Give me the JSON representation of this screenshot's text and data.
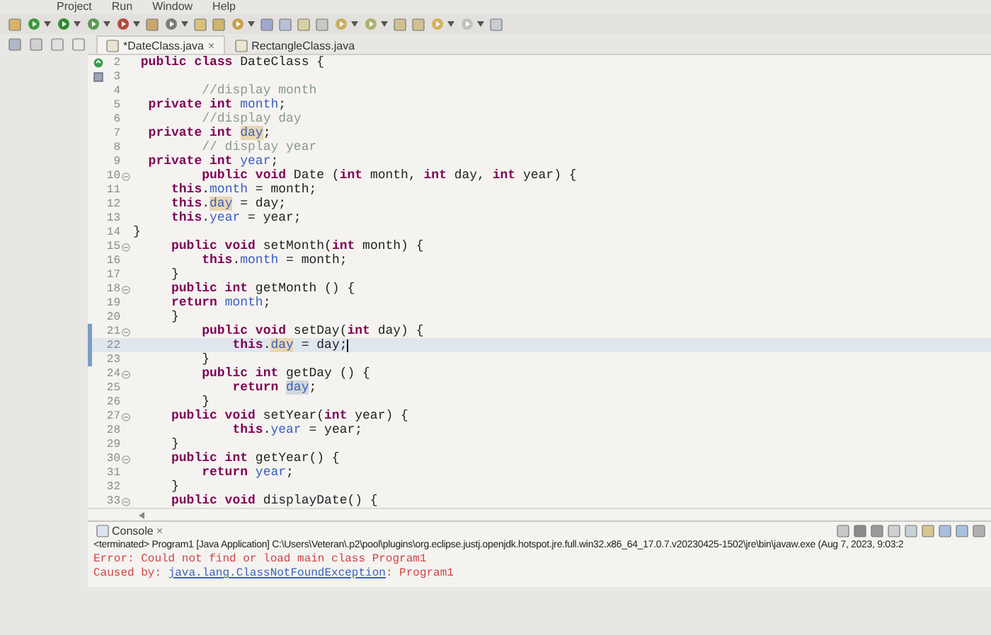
{
  "menu": [
    "Project",
    "Run",
    "Window",
    "Help"
  ],
  "tabs": [
    {
      "label": "*DateClass.java",
      "selected": true,
      "close": "×"
    },
    {
      "label": "RectangleClass.java",
      "selected": false
    }
  ],
  "editor": {
    "lines": [
      {
        "number": "2",
        "marker": {
          "kind": "override"
        },
        "fold": false,
        "marked": false,
        "current": false,
        "tokens": [
          {
            "kind": "kw",
            "text": " public class"
          },
          {
            "kind": "text",
            "text": " DateClass {"
          }
        ]
      },
      {
        "number": "3",
        "marker": {
          "kind": "bookmark"
        },
        "fold": false,
        "marked": false,
        "current": false
      },
      {
        "number": "4",
        "fold": false,
        "marked": false,
        "current": false,
        "tokens": [
          {
            "kind": "comment",
            "text": "         //display month"
          }
        ]
      },
      {
        "number": "5",
        "fold": false,
        "marked": false,
        "current": false,
        "tokens": [
          {
            "kind": "kw",
            "text": "  private int "
          },
          {
            "kind": "field",
            "text": "month"
          },
          {
            "kind": "text",
            "text": ";"
          }
        ]
      },
      {
        "number": "6",
        "fold": false,
        "marked": false,
        "current": false,
        "tokens": [
          {
            "kind": "comment",
            "text": "         //display day"
          }
        ]
      },
      {
        "number": "7",
        "fold": false,
        "marked": false,
        "current": false,
        "tokens": [
          {
            "kind": "kw",
            "text": "  private int "
          },
          {
            "kind": "field-write",
            "text": "day"
          },
          {
            "kind": "text",
            "text": ";"
          }
        ]
      },
      {
        "number": "8",
        "fold": false,
        "marked": false,
        "current": false,
        "tokens": [
          {
            "kind": "comment",
            "text": "         // display year"
          }
        ]
      },
      {
        "number": "9",
        "fold": false,
        "marked": false,
        "current": false,
        "tokens": [
          {
            "kind": "kw",
            "text": "  private int "
          },
          {
            "kind": "field",
            "text": "year"
          },
          {
            "kind": "text",
            "text": ";"
          }
        ]
      },
      {
        "number": "10",
        "fold": true,
        "marked": false,
        "current": false,
        "tokens": [
          {
            "kind": "kw",
            "text": "         public void"
          },
          {
            "kind": "text",
            "text": " Date ("
          },
          {
            "kind": "kw",
            "text": "int"
          },
          {
            "kind": "text",
            "text": " month, "
          },
          {
            "kind": "kw",
            "text": "int"
          },
          {
            "kind": "text",
            "text": " day, "
          },
          {
            "kind": "kw",
            "text": "int"
          },
          {
            "kind": "text",
            "text": " year) {"
          }
        ]
      },
      {
        "number": "11",
        "fold": false,
        "marked": false,
        "current": false,
        "tokens": [
          {
            "kind": "kw",
            "text": "     this"
          },
          {
            "kind": "text",
            "text": "."
          },
          {
            "kind": "field",
            "text": "month"
          },
          {
            "kind": "text",
            "text": " = month;"
          }
        ]
      },
      {
        "number": "12",
        "fold": false,
        "marked": false,
        "current": false,
        "tokens": [
          {
            "kind": "kw",
            "text": "     this"
          },
          {
            "kind": "text",
            "text": "."
          },
          {
            "kind": "field-write",
            "text": "day"
          },
          {
            "kind": "text",
            "text": " = day;"
          }
        ]
      },
      {
        "number": "13",
        "fold": false,
        "marked": false,
        "current": false,
        "tokens": [
          {
            "kind": "kw",
            "text": "     this"
          },
          {
            "kind": "text",
            "text": "."
          },
          {
            "kind": "field",
            "text": "year"
          },
          {
            "kind": "text",
            "text": " = year;"
          }
        ]
      },
      {
        "number": "14",
        "fold": false,
        "marked": false,
        "current": false,
        "tokens": [
          {
            "kind": "text",
            "text": "}"
          }
        ]
      },
      {
        "number": "15",
        "fold": true,
        "marked": false,
        "current": false,
        "tokens": [
          {
            "kind": "kw",
            "text": "     public void"
          },
          {
            "kind": "text",
            "text": " setMonth("
          },
          {
            "kind": "kw",
            "text": "int"
          },
          {
            "kind": "text",
            "text": " month) {"
          }
        ]
      },
      {
        "number": "16",
        "fold": false,
        "marked": false,
        "current": false,
        "tokens": [
          {
            "kind": "kw",
            "text": "         this"
          },
          {
            "kind": "text",
            "text": "."
          },
          {
            "kind": "field",
            "text": "month"
          },
          {
            "kind": "text",
            "text": " = month;"
          }
        ]
      },
      {
        "number": "17",
        "fold": false,
        "marked": false,
        "current": false,
        "tokens": [
          {
            "kind": "text",
            "text": "     }"
          }
        ]
      },
      {
        "number": "18",
        "fold": true,
        "marked": false,
        "current": false,
        "tokens": [
          {
            "kind": "kw",
            "text": "     public int"
          },
          {
            "kind": "text",
            "text": " getMonth () {"
          }
        ]
      },
      {
        "number": "19",
        "fold": false,
        "marked": false,
        "current": false,
        "tokens": [
          {
            "kind": "kw",
            "text": "     return "
          },
          {
            "kind": "field",
            "text": "month"
          },
          {
            "kind": "text",
            "text": ";"
          }
        ]
      },
      {
        "number": "20",
        "fold": false,
        "marked": false,
        "current": false,
        "tokens": [
          {
            "kind": "text",
            "text": "     }"
          }
        ]
      },
      {
        "number": "21",
        "fold": true,
        "marked": true,
        "current": false,
        "tokens": [
          {
            "kind": "kw",
            "text": "         public void"
          },
          {
            "kind": "text",
            "text": " setDay("
          },
          {
            "kind": "kw",
            "text": "int"
          },
          {
            "kind": "text",
            "text": " day) {"
          }
        ]
      },
      {
        "number": "22",
        "fold": false,
        "marked": true,
        "current": true,
        "tokens": [
          {
            "kind": "kw",
            "text": "             this"
          },
          {
            "kind": "text",
            "text": "."
          },
          {
            "kind": "field-write",
            "text": "day"
          },
          {
            "kind": "text",
            "text": " = day;"
          }
        ]
      },
      {
        "number": "23",
        "fold": false,
        "marked": true,
        "current": false,
        "tokens": [
          {
            "kind": "text",
            "text": "         }"
          }
        ]
      },
      {
        "number": "24",
        "fold": true,
        "marked": false,
        "current": false,
        "tokens": [
          {
            "kind": "kw",
            "text": "         public int"
          },
          {
            "kind": "text",
            "text": " getDay () {"
          }
        ]
      },
      {
        "number": "25",
        "fold": false,
        "marked": false,
        "current": false,
        "tokens": [
          {
            "kind": "kw",
            "text": "             return "
          },
          {
            "kind": "field-read",
            "text": "day"
          },
          {
            "kind": "text",
            "text": ";"
          }
        ]
      },
      {
        "number": "26",
        "fold": false,
        "marked": false,
        "current": false,
        "tokens": [
          {
            "kind": "text",
            "text": "         }"
          }
        ]
      },
      {
        "number": "27",
        "fold": true,
        "marked": false,
        "current": false,
        "tokens": [
          {
            "kind": "kw",
            "text": "     public void"
          },
          {
            "kind": "text",
            "text": " setYear("
          },
          {
            "kind": "kw",
            "text": "int"
          },
          {
            "kind": "text",
            "text": " year) {"
          }
        ]
      },
      {
        "number": "28",
        "fold": false,
        "marked": false,
        "current": false,
        "tokens": [
          {
            "kind": "kw",
            "text": "             this"
          },
          {
            "kind": "text",
            "text": "."
          },
          {
            "kind": "field",
            "text": "year"
          },
          {
            "kind": "text",
            "text": " = year;"
          }
        ]
      },
      {
        "number": "29",
        "fold": false,
        "marked": false,
        "current": false,
        "tokens": [
          {
            "kind": "text",
            "text": "     }"
          }
        ]
      },
      {
        "number": "30",
        "fold": true,
        "marked": false,
        "current": false,
        "tokens": [
          {
            "kind": "kw",
            "text": "     public int"
          },
          {
            "kind": "text",
            "text": " getYear() {"
          }
        ]
      },
      {
        "number": "31",
        "fold": false,
        "marked": false,
        "current": false,
        "tokens": [
          {
            "kind": "kw",
            "text": "         return "
          },
          {
            "kind": "field",
            "text": "year"
          },
          {
            "kind": "text",
            "text": ";"
          }
        ]
      },
      {
        "number": "32",
        "fold": false,
        "marked": false,
        "current": false,
        "tokens": [
          {
            "kind": "text",
            "text": "     }"
          }
        ]
      },
      {
        "number": "33",
        "fold": true,
        "marked": false,
        "current": false,
        "tokens": [
          {
            "kind": "kw",
            "text": "     public void"
          },
          {
            "kind": "text",
            "text": " displayDate() {"
          }
        ]
      }
    ]
  },
  "console": {
    "tab": {
      "label": "Console",
      "close": "×"
    },
    "lines": [
      {
        "kind": "info",
        "text": "<terminated> Program1 [Java Application] C:\\Users\\Veteran\\.p2\\pool\\plugins\\org.eclipse.justj.openjdk.hotspot.jre.full.win32.x86_64_17.0.7.v20230425-1502\\jre\\bin\\javaw.exe  (Aug 7, 2023, 9:03:2"
      },
      {
        "kind": "error",
        "text": "Error: Could not find or load main class Program1"
      },
      {
        "kind": "exception",
        "prefix": "Caused by: ",
        "link": "java.lang.ClassNotFoundException",
        "suffix": ": Program1"
      }
    ]
  }
}
